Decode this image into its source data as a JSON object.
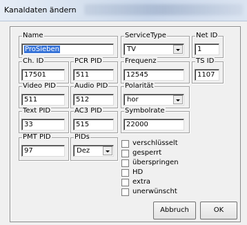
{
  "window": {
    "title": "Kanaldaten ändern"
  },
  "fields": {
    "name": {
      "label": "Name",
      "value": "ProSieben"
    },
    "servicetype": {
      "label": "ServiceType",
      "value": "TV"
    },
    "net_id": {
      "label": "Net ID",
      "value": "1"
    },
    "ch_id": {
      "label": "Ch. ID",
      "value": "17501"
    },
    "pcr_pid": {
      "label": "PCR PID",
      "value": "511"
    },
    "frequenz": {
      "label": "Frequenz",
      "value": "12545"
    },
    "ts_id": {
      "label": "TS ID",
      "value": "1107"
    },
    "video_pid": {
      "label": "Video PID",
      "value": "511"
    },
    "audio_pid": {
      "label": "Audio PID",
      "value": "512"
    },
    "polaritaet": {
      "label": "Polarität",
      "value": "hor"
    },
    "text_pid": {
      "label": "Text PID",
      "value": "33"
    },
    "ac3_pid": {
      "label": "AC3 PID",
      "value": "515"
    },
    "symbolrate": {
      "label": "Symbolrate",
      "value": "22000"
    },
    "pmt_pid": {
      "label": "PMT PID",
      "value": "97"
    },
    "pids": {
      "label": "PIDs",
      "value": "Dez"
    }
  },
  "checkboxes": [
    {
      "label": "verschlüsselt",
      "checked": false
    },
    {
      "label": "gesperrt",
      "checked": false
    },
    {
      "label": "überspringen",
      "checked": false
    },
    {
      "label": "HD",
      "checked": false
    },
    {
      "label": "extra",
      "checked": false
    },
    {
      "label": "unerwünscht",
      "checked": false
    }
  ],
  "buttons": {
    "cancel": "Abbruch",
    "ok": "OK"
  },
  "icons": {
    "dropdown": "chevron-down-icon"
  },
  "colors": {
    "selection": "#3874d8",
    "window_bg": "#f0f0f0"
  }
}
